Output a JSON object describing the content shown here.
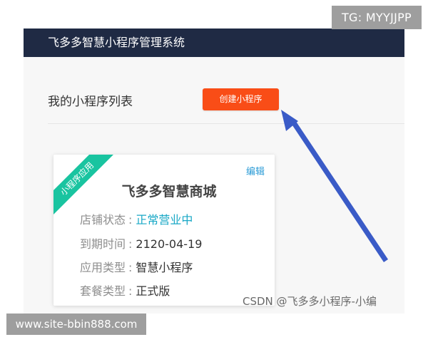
{
  "overlay": {
    "tg_badge": "TG: MYYJJPP",
    "site_badge": "www.site-bbin888.com",
    "watermark": "CSDN @飞多多小程序-小编"
  },
  "topbar": {
    "title": "飞多多智慧小程序管理系统"
  },
  "main": {
    "list_title": "我的小程序列表",
    "create_button": "创建小程序"
  },
  "card": {
    "ribbon": "小程序应用",
    "edit": "编辑",
    "name": "飞多多智慧商城",
    "rows": [
      {
        "label": "店铺状态",
        "value": "正常营业中"
      },
      {
        "label": "到期时间",
        "value": "2120-04-19"
      },
      {
        "label": "应用类型",
        "value": "智慧小程序"
      },
      {
        "label": "套餐类型",
        "value": "正式版"
      }
    ]
  },
  "colors": {
    "topbar": "#1f2a44",
    "create_button": "#f94d17",
    "ribbon": "#19c4a0",
    "link": "#2a9bd6",
    "status": "#19a8c6",
    "arrow": "#3a5bc7",
    "overlay_badge": "#9e9e9e"
  },
  "annotation": {
    "icon": "arrow-icon"
  }
}
